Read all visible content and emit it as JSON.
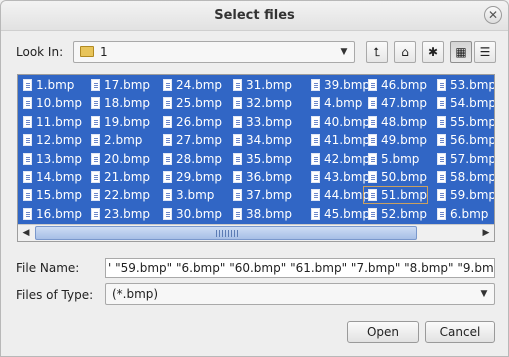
{
  "dialog": {
    "title": "Select files",
    "close_glyph": "✕"
  },
  "look_in": {
    "label": "Look In:",
    "value": "1",
    "folder_icon": "folder-icon"
  },
  "toolbar": {
    "buttons": [
      {
        "name": "up-folder-icon",
        "glyph": "⮤"
      },
      {
        "name": "home-icon",
        "glyph": "⌂"
      },
      {
        "name": "new-folder-icon",
        "glyph": "✱"
      },
      {
        "name": "list-view-icon",
        "glyph": "▦",
        "active": true
      },
      {
        "name": "details-view-icon",
        "glyph": "☰",
        "active": false
      }
    ]
  },
  "files": {
    "columns": [
      [
        "1.bmp",
        "10.bmp",
        "11.bmp",
        "12.bmp",
        "13.bmp",
        "14.bmp",
        "15.bmp",
        "16.bmp"
      ],
      [
        "17.bmp",
        "18.bmp",
        "19.bmp",
        "2.bmp",
        "20.bmp",
        "21.bmp",
        "22.bmp",
        "23.bmp"
      ],
      [
        "24.bmp",
        "25.bmp",
        "26.bmp",
        "27.bmp",
        "28.bmp",
        "29.bmp",
        "3.bmp",
        "30.bmp"
      ],
      [
        "31.bmp",
        "32.bmp",
        "33.bmp",
        "34.bmp",
        "35.bmp",
        "36.bmp",
        "37.bmp",
        "38.bmp"
      ],
      [
        "39.bmp",
        "4.bmp",
        "40.bmp",
        "41.bmp",
        "42.bmp",
        "43.bmp",
        "44.bmp",
        "45.bmp"
      ],
      [
        "46.bmp",
        "47.bmp",
        "48.bmp",
        "49.bmp",
        "5.bmp",
        "50.bmp",
        "51.bmp",
        "52.bmp"
      ],
      [
        "53.bmp",
        "54.bmp",
        "55.bmp",
        "56.bmp",
        "57.bmp",
        "58.bmp",
        "59.bmp",
        "6.bmp"
      ]
    ],
    "focused": "51.bmp"
  },
  "file_name": {
    "label": "File Name:",
    "value": "' \"59.bmp\" \"6.bmp\" \"60.bmp\" \"61.bmp\" \"7.bmp\" \"8.bmp\" \"9.bmp\""
  },
  "file_type": {
    "label": "Files of Type:",
    "value": "(*.bmp)"
  },
  "actions": {
    "open": "Open",
    "cancel": "Cancel"
  },
  "colors": {
    "selection": "#3166c5",
    "focus_outline": "#c9a060"
  }
}
